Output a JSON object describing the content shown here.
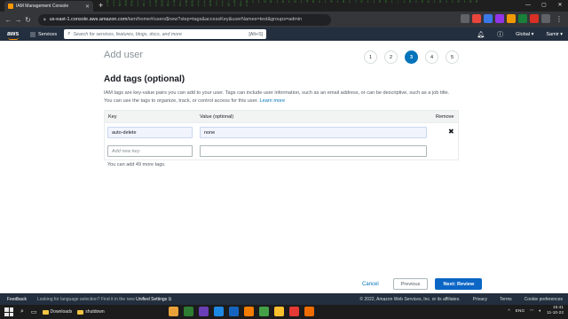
{
  "browser": {
    "tab_title": "IAM Management Console",
    "tab_close": "✕",
    "new_tab": "+",
    "matrix_text": "0 1 1 0 ø 7 ¦ 1 0 0 1 ¥ 1 0 ø 1 1 0 7 1 ¦ 0 1 0 1 1 0 0 1 ø 1 0 1 ¥ 0 1 1 0 1 0 1 7 0 1 1 0 0 1 ¦ 1 0 1 0 ø 1 0 1 1 0 1 0 0 1 1 0 ¥ 0 1 0 1 1 0 0 1 0 1 0 1 1 0 7 1 0 1 0 1",
    "url_host": "us-east-1.console.aws.amazon.com",
    "url_path": "/iam/home#/users$new?step=tags&accessKey&userNames=test&groups=admin",
    "window_controls": [
      "—",
      "▢",
      "✕"
    ],
    "extensions": [
      {
        "name": "ext-1",
        "color": "#5f6368"
      },
      {
        "name": "ext-2",
        "color": "#e8453c"
      },
      {
        "name": "ext-3",
        "color": "#3b78e7"
      },
      {
        "name": "ext-4",
        "color": "#9334e6"
      },
      {
        "name": "ext-5",
        "color": "#f29900"
      },
      {
        "name": "ext-6",
        "color": "#188038"
      },
      {
        "name": "ext-7",
        "color": "#d93025"
      },
      {
        "name": "ext-8",
        "color": "#5f6368"
      }
    ]
  },
  "aws_nav": {
    "logo": "aws",
    "services": "Services",
    "search_placeholder": "Search for services, features, blogs, docs, and more",
    "search_shortcut": "[Alt+S]",
    "region": "Global ▾",
    "user": "Samir ▾"
  },
  "page": {
    "title": "Add user",
    "steps": [
      "1",
      "2",
      "3",
      "4",
      "5"
    ],
    "active_step": 3,
    "section_title": "Add tags (optional)",
    "description": "IAM tags are key-value pairs you can add to your user. Tags can include user information, such as an email address, or can be descriptive, such as a job title. You can use the tags to organize, track, or control access for this user.",
    "learn_more": "Learn more",
    "table": {
      "headers": {
        "key": "Key",
        "value": "Value (optional)",
        "remove": "Remove"
      },
      "rows": [
        {
          "key": "auto-delete",
          "value": "none",
          "remove": "✖"
        }
      ],
      "new_key_placeholder": "Add new key",
      "new_value_placeholder": ""
    },
    "remaining": "You can add 49 more tags.",
    "buttons": {
      "cancel": "Cancel",
      "previous": "Previous",
      "next": "Next: Review"
    }
  },
  "footer": {
    "feedback": "Feedback",
    "language_prompt": "Looking for language selection? Find it in the new",
    "unified_settings": "Unified Settings",
    "copyright": "© 2022, Amazon Web Services, Inc. or its affiliates.",
    "privacy": "Privacy",
    "terms": "Terms",
    "cookies": "Cookie preferences"
  },
  "taskbar": {
    "search_icon": "⌕",
    "taskview_icon": "▭",
    "downloads": "Downloads",
    "shutdown": "shutdown",
    "apps": [
      {
        "name": "app-1",
        "color": "#e9a23b"
      },
      {
        "name": "app-2",
        "color": "#2f7d32"
      },
      {
        "name": "app-3",
        "color": "#6a3fb5"
      },
      {
        "name": "app-4",
        "color": "#1e88e5"
      },
      {
        "name": "app-5",
        "color": "#1565c0"
      },
      {
        "name": "app-6",
        "color": "#f57c00"
      },
      {
        "name": "app-7",
        "color": "#43a047"
      },
      {
        "name": "app-8",
        "color": "#fbc02d"
      },
      {
        "name": "app-9",
        "color": "#e53935"
      },
      {
        "name": "app-10",
        "color": "#ef6c00"
      }
    ],
    "tray_arrow": "^",
    "lang": "ENG",
    "time": "15:41",
    "date": "11-10-22"
  }
}
